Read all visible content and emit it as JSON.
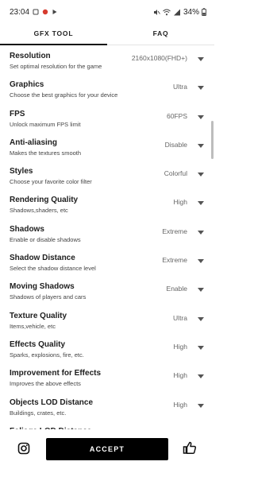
{
  "status_bar": {
    "time": "23:04",
    "battery": "34%"
  },
  "tabs": [
    {
      "label": "GFX TOOL",
      "active": true
    },
    {
      "label": "FAQ",
      "active": false
    }
  ],
  "settings": [
    {
      "title": "Resolution",
      "description": "Set optimal resolution for the game",
      "value": "2160x1080(FHD+)"
    },
    {
      "title": "Graphics",
      "description": "Choose the best graphics for your device",
      "value": "Ultra"
    },
    {
      "title": "FPS",
      "description": "Unlock maximum FPS limit",
      "value": "60FPS"
    },
    {
      "title": "Anti-aliasing",
      "description": "Makes the textures smooth",
      "value": "Disable"
    },
    {
      "title": "Styles",
      "description": "Choose your favorite color filter",
      "value": "Colorful"
    },
    {
      "title": "Rendering Quality",
      "description": "Shadows,shaders, etc",
      "value": "High"
    },
    {
      "title": "Shadows",
      "description": "Enable or disable shadows",
      "value": "Extreme"
    },
    {
      "title": "Shadow Distance",
      "description": "Select the shadow distance level",
      "value": "Extreme"
    },
    {
      "title": "Moving Shadows",
      "description": "Shadows of players and cars",
      "value": "Enable"
    },
    {
      "title": "Texture Quality",
      "description": "Items,vehicle, etc",
      "value": "Ultra"
    },
    {
      "title": "Effects Quality",
      "description": "Sparks, explosions, fire, etc.",
      "value": "High"
    },
    {
      "title": "Improvement for Effects",
      "description": "Improves the above effects",
      "value": "High"
    },
    {
      "title": "Objects LOD Distance",
      "description": "Buildings, crates, etc.",
      "value": "High"
    },
    {
      "title": "Foliage LOD Distance",
      "description": "",
      "value": ""
    }
  ],
  "bottom": {
    "accept_label": "ACCEPT"
  },
  "icons": [
    "instagram-icon",
    "thumbs-up-icon",
    "wifi-icon",
    "signal-icon",
    "battery-icon",
    "caret-down-icon"
  ]
}
